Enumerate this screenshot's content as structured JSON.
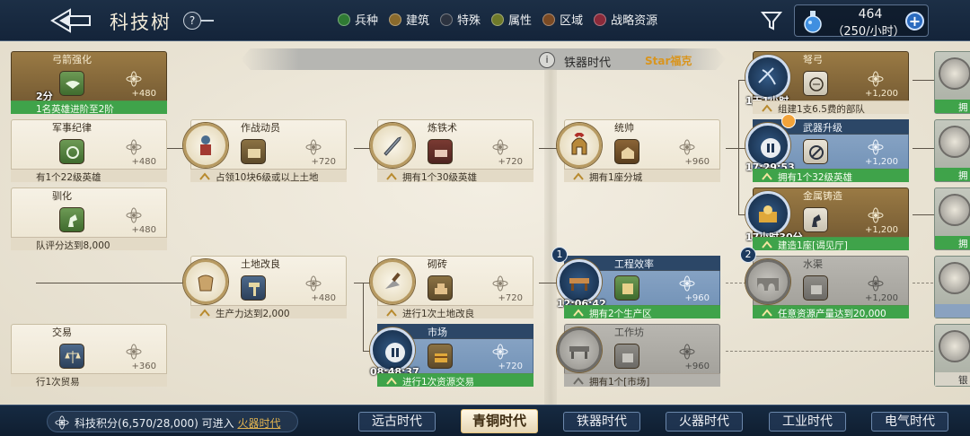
{
  "header": {
    "title": "科技树",
    "help_label": "?",
    "legend": [
      {
        "label": "兵种",
        "color": "#2f7a33"
      },
      {
        "label": "建筑",
        "color": "#8a6a2c"
      },
      {
        "label": "特殊",
        "color": "#2c3340"
      },
      {
        "label": "属性",
        "color": "#6f7a2a"
      },
      {
        "label": "区域",
        "color": "#7a4a24"
      },
      {
        "label": "战略资源",
        "color": "#8a2a3a"
      }
    ],
    "resource": {
      "amount": "464",
      "rate": "（250/小时）"
    },
    "plus_label": "+"
  },
  "era_banner": {
    "info": "i",
    "name": "铁器时代",
    "tag": "Star福克"
  },
  "cards": {
    "c1": {
      "name": "弓箭强化",
      "points": "+480",
      "req": "1名英雄进阶至2阶",
      "timer": "2分"
    },
    "c2": {
      "name": "军事纪律",
      "points": "+480",
      "req": "有1个22级英雄"
    },
    "c3": {
      "name": "驯化",
      "points": "+480",
      "req": "队评分达到8,000"
    },
    "c4": {
      "name": "作战动员",
      "points": "+720",
      "req": "占领10块6级或以上土地"
    },
    "c5": {
      "name": "土地改良",
      "points": "+480",
      "req": "生产力达到2,000"
    },
    "c6": {
      "name": "交易",
      "points": "+360",
      "req": "行1次贸易"
    },
    "c7": {
      "name": "炼铁术",
      "points": "+720",
      "req": "拥有1个30级英雄"
    },
    "c8": {
      "name": "砌砖",
      "points": "+720",
      "req": "进行1次土地改良"
    },
    "c9": {
      "name": "市场",
      "points": "+720",
      "req": "进行1次资源交易",
      "timer": "08:48:37"
    },
    "c10": {
      "name": "统帅",
      "points": "+960",
      "req": "拥有1座分城"
    },
    "c11": {
      "name": "工程效率",
      "points": "+960",
      "req": "拥有2个生产区",
      "timer": "12:06:42",
      "badge": "1"
    },
    "c12": {
      "name": "工作坊",
      "points": "+960",
      "req": "拥有1个[市场]"
    },
    "c13": {
      "name": "弩弓",
      "points": "+1,200",
      "req": "组建1支6.5费的部队",
      "timer": "1天1小时"
    },
    "c14": {
      "name": "武器升级",
      "points": "+1,200",
      "req": "拥有1个32级英雄",
      "timer": "17:29:53"
    },
    "c15": {
      "name": "金属铸造",
      "points": "+1,200",
      "req": "建造1座[谒见厅]",
      "timer": "17小时30分"
    },
    "c16": {
      "name": "水渠",
      "points": "+1,200",
      "req": "任意资源产量达到20,000",
      "badge": "2"
    }
  },
  "stubs": [
    "拥",
    "拥",
    "拥",
    "",
    "银"
  ],
  "footer": {
    "score_label": "科技积分",
    "score_value": "(6,570/28,000)",
    "score_hint": "可进入",
    "score_era": "火器时代",
    "tabs": [
      "远古时代",
      "青铜时代",
      "铁器时代",
      "火器时代",
      "工业时代",
      "电气时代"
    ],
    "selected_tab": "青铜时代"
  }
}
